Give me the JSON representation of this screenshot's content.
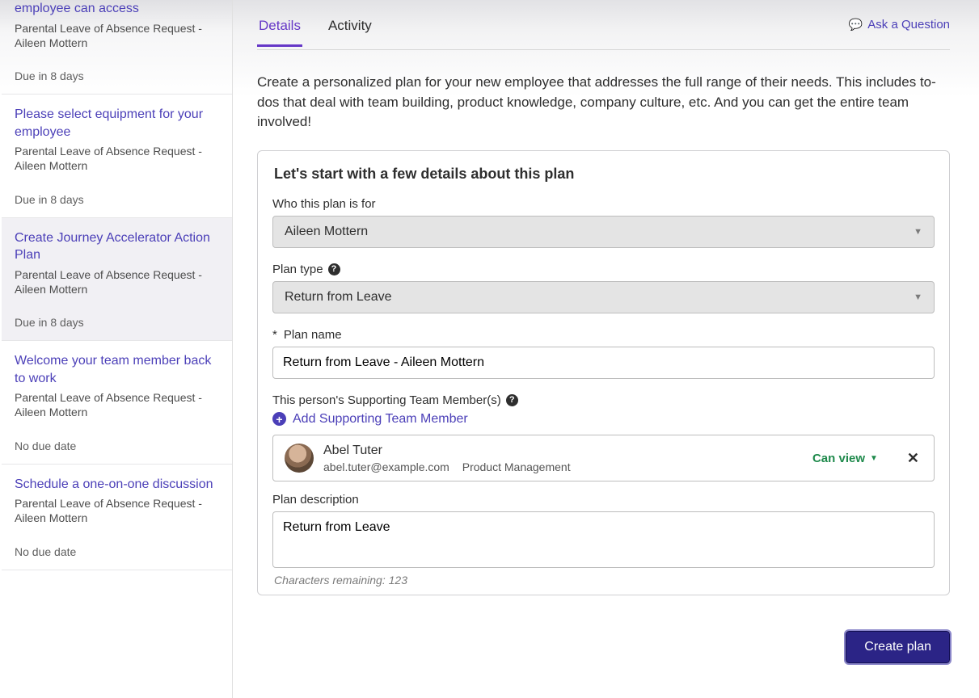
{
  "sidebar": {
    "items": [
      {
        "title": "employee can access",
        "sub": "Parental Leave of Absence Request - Aileen Mottern",
        "due": "Due in 8 days"
      },
      {
        "title": "Please select equipment for your employee",
        "sub": "Parental Leave of Absence Request - Aileen Mottern",
        "due": "Due in 8 days"
      },
      {
        "title": "Create Journey Accelerator Action Plan",
        "sub": "Parental Leave of Absence Request - Aileen Mottern",
        "due": "Due in 8 days"
      },
      {
        "title": "Welcome your team member back to work",
        "sub": "Parental Leave of Absence Request - Aileen Mottern",
        "due": "No due date"
      },
      {
        "title": "Schedule a one-on-one discussion",
        "sub": "Parental Leave of Absence Request - Aileen Mottern",
        "due": "No due date"
      }
    ]
  },
  "tabs": {
    "details": "Details",
    "activity": "Activity"
  },
  "ask_question": "Ask a Question",
  "intro": "Create a personalized plan for your new employee that addresses the full range of their needs. This includes to-dos that deal with team building, product knowledge, company culture, etc. And you can get the entire team involved!",
  "card_title": "Let's start with a few details about this plan",
  "labels": {
    "who_for": "Who this plan is for",
    "plan_type": "Plan type",
    "plan_name": "Plan name",
    "supporting": "This person's Supporting Team Member(s)",
    "add_member": "Add Supporting Team Member",
    "description": "Plan description"
  },
  "values": {
    "who_for": "Aileen Mottern",
    "plan_type": "Return from Leave",
    "plan_name": "Return from Leave - Aileen Mottern",
    "description": "Return from Leave"
  },
  "member": {
    "name": "Abel Tuter",
    "email": "abel.tuter@example.com",
    "dept": "Product Management",
    "permission": "Can view"
  },
  "chars_remaining_prefix": "Characters remaining: ",
  "chars_remaining": "123",
  "create_btn": "Create plan",
  "required_mark": "*"
}
